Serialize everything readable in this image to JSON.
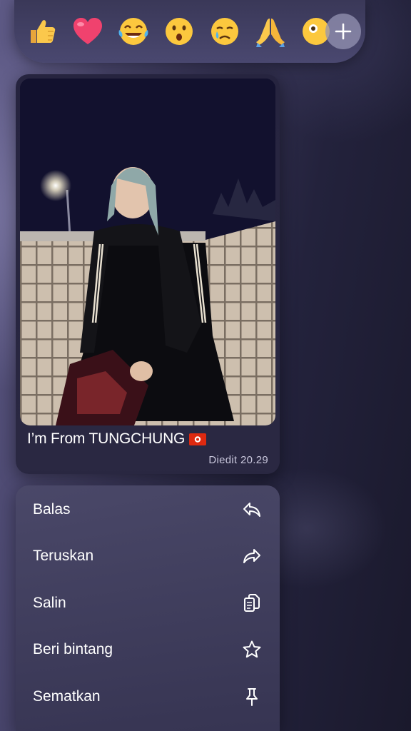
{
  "reactions": [
    {
      "icon": "thumbs-up-emoji"
    },
    {
      "icon": "red-heart-emoji"
    },
    {
      "icon": "tears-of-joy-emoji"
    },
    {
      "icon": "surprised-face-emoji"
    },
    {
      "icon": "crying-face-emoji"
    },
    {
      "icon": "folded-hands-emoji"
    },
    {
      "icon": "partial-emoji"
    }
  ],
  "add_reaction_icon": "plus-icon",
  "message": {
    "caption": "I’m From TUNGCHUNG",
    "flag_icon": "hong-kong-flag",
    "meta": "Diedit 20.29"
  },
  "menu": {
    "items": [
      {
        "label": "Balas",
        "icon": "reply-icon"
      },
      {
        "label": "Teruskan",
        "icon": "forward-icon"
      },
      {
        "label": "Salin",
        "icon": "copy-icon"
      },
      {
        "label": "Beri bintang",
        "icon": "star-icon"
      },
      {
        "label": "Sematkan",
        "icon": "pin-icon"
      }
    ]
  },
  "colors": {
    "background": "#2b2944",
    "menu": "#45436a",
    "text": "#ffffff",
    "meta_text": "#c9c7dc",
    "hk_flag": "#de2910"
  }
}
